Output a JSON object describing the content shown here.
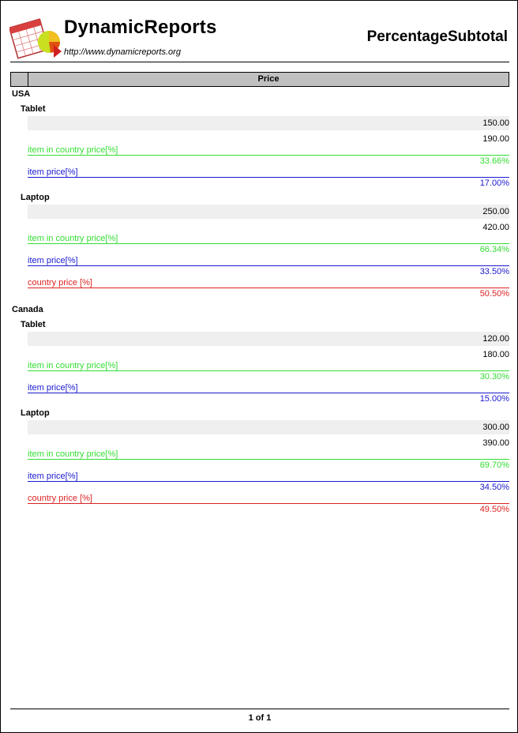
{
  "header": {
    "brand": "DynamicReports",
    "url": "http://www.dynamicreports.org",
    "report_title": "PercentageSubtotal"
  },
  "table": {
    "column_header": "Price"
  },
  "colors": {
    "item_in_country": "#33dd33",
    "item": "#1a1ad0",
    "country": "#dd2222",
    "header_bg": "#c0c0c0",
    "row_shade": "#efefef"
  },
  "groups": [
    {
      "country": "USA",
      "items": [
        {
          "item": "Tablet",
          "prices": [
            "150.00",
            "190.00"
          ],
          "item_in_country_label": "item in country price[%]",
          "item_in_country_value": "33.66%",
          "item_label": "item price[%]",
          "item_value": "17.00%"
        },
        {
          "item": "Laptop",
          "prices": [
            "250.00",
            "420.00"
          ],
          "item_in_country_label": "item in country price[%]",
          "item_in_country_value": "66.34%",
          "item_label": "item price[%]",
          "item_value": "33.50%"
        }
      ],
      "country_label": "country price [%]",
      "country_value": "50.50%"
    },
    {
      "country": "Canada",
      "items": [
        {
          "item": "Tablet",
          "prices": [
            "120.00",
            "180.00"
          ],
          "item_in_country_label": "item in country price[%]",
          "item_in_country_value": "30.30%",
          "item_label": "item price[%]",
          "item_value": "15.00%"
        },
        {
          "item": "Laptop",
          "prices": [
            "300.00",
            "390.00"
          ],
          "item_in_country_label": "item in country price[%]",
          "item_in_country_value": "69.70%",
          "item_label": "item price[%]",
          "item_value": "34.50%"
        }
      ],
      "country_label": "country price [%]",
      "country_value": "49.50%"
    }
  ],
  "footer": {
    "page_label": "1 of 1"
  }
}
